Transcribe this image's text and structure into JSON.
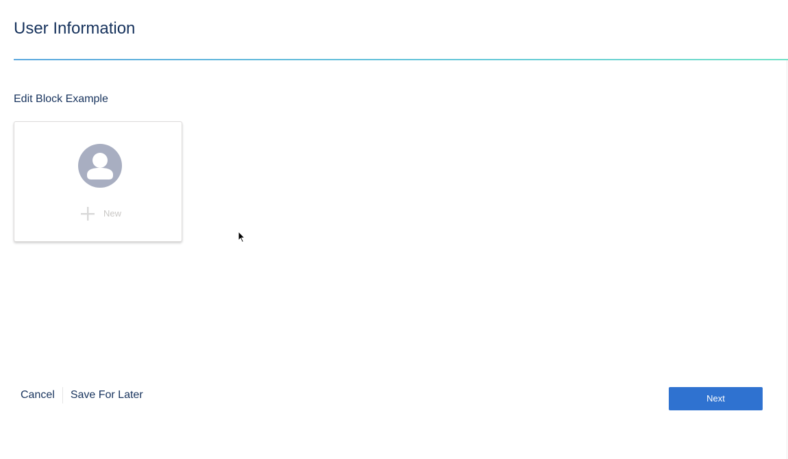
{
  "header": {
    "title": "User Information"
  },
  "section": {
    "label": "Edit Block Example"
  },
  "block_card": {
    "avatar_icon": "user-avatar-icon",
    "add_icon": "plus-icon",
    "new_label": "New"
  },
  "footer": {
    "cancel_label": "Cancel",
    "save_for_later_label": "Save For Later",
    "next_label": "Next"
  },
  "colors": {
    "title_text": "#16325c",
    "divider_start": "#5aa7de",
    "divider_end": "#6fe0c6",
    "avatar_fill": "#a8aec1",
    "placeholder_text": "#c9c7c5",
    "next_button_bg": "#2f72d0",
    "next_button_text": "#ffffff"
  }
}
